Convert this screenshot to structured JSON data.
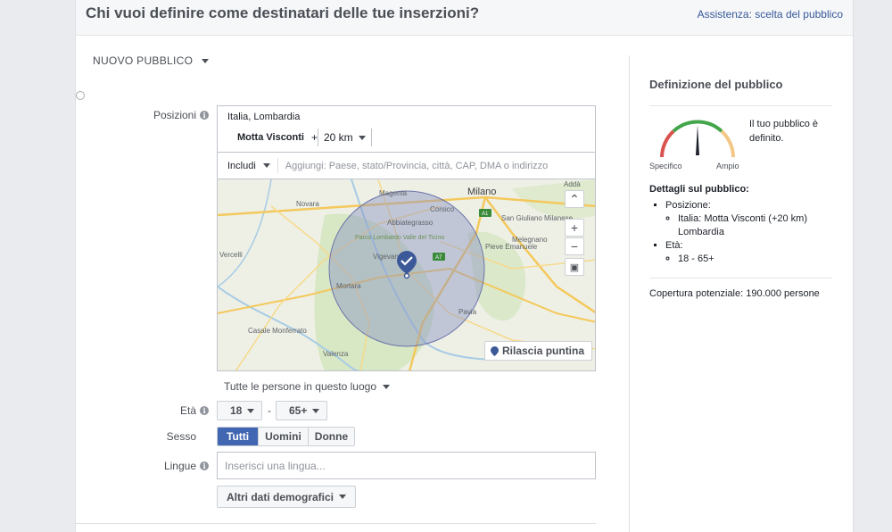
{
  "header": {
    "title": "Chi vuoi definire come destinatari delle tue inserzioni?",
    "help_link": "Assistenza: scelta del pubblico"
  },
  "audience": {
    "selector_label": "NUOVO PUBBLICO"
  },
  "location": {
    "label": "Posizioni",
    "region": "Italia, Lombardia",
    "city": "Motta Visconti",
    "plus": "+",
    "radius": "20 km",
    "include_label": "Includi",
    "search_placeholder": "Aggiungi: Paese, stato/Provincia, città, CAP, DMA o indirizzo",
    "people_scope": "Tutte le persone in questo luogo"
  },
  "map": {
    "places": [
      "Magenta",
      "Corsico",
      "Milano",
      "Addà",
      "Novara",
      "Abbiategrasso",
      "San Giuliano Milanese",
      "Melegnano",
      "Parco Lombardo Valle del Ticino",
      "Vigevano",
      "Pieve Emanuele",
      "Mortara",
      "Pavia",
      "Vercelli",
      "Casale Monferrato",
      "Valenza"
    ],
    "road_labels": [
      "A1",
      "A7"
    ],
    "drop_pin_label": "Rilascia puntina",
    "colors": {
      "radius_fill": "#8a93c6",
      "pin": "#3b5998",
      "land": "#eef0e6",
      "green": "#cfe3b5"
    }
  },
  "age": {
    "label": "Età",
    "min": "18",
    "max": "65+",
    "separator": "-"
  },
  "gender": {
    "label": "Sesso",
    "options": [
      "Tutti",
      "Uomini",
      "Donne"
    ],
    "selected": "Tutti"
  },
  "languages": {
    "label": "Lingue",
    "placeholder": "Inserisci una lingua..."
  },
  "more_demographics": "Altri dati demografici",
  "sidebar": {
    "title": "Definizione del pubblico",
    "gauge": {
      "left_label": "Specifico",
      "right_label": "Ampio",
      "message": "Il tuo pubblico è definito.",
      "level": 0.5
    },
    "details_title": "Dettagli sul pubblico:",
    "position_title": "Posizione:",
    "position_value_1": "Italia: Motta Visconti (+20 km)",
    "position_value_2": "Lombardia",
    "age_title": "Età:",
    "age_value": "18 - 65+",
    "reach": "Copertura potenziale: 190.000 persone"
  }
}
